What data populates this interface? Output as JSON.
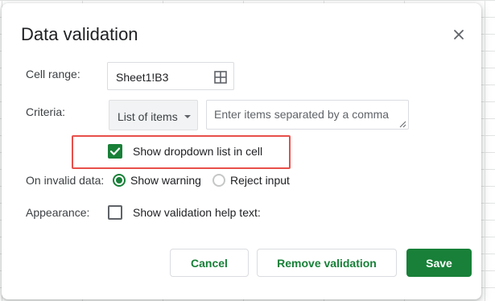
{
  "dialog": {
    "title": "Data validation"
  },
  "cell_range": {
    "label": "Cell range:",
    "value": "Sheet1!B3"
  },
  "criteria": {
    "label": "Criteria:",
    "selected": "List of items",
    "items_placeholder": "Enter items separated by a comma"
  },
  "dropdown_option": {
    "label": "Show dropdown list in cell",
    "checked": true
  },
  "invalid_data": {
    "label": "On invalid data:",
    "options": [
      "Show warning",
      "Reject input"
    ],
    "selected": "Show warning"
  },
  "appearance": {
    "label": "Appearance:",
    "help_text_label": "Show validation help text:",
    "checked": false
  },
  "buttons": {
    "cancel": "Cancel",
    "remove": "Remove validation",
    "save": "Save"
  },
  "colors": {
    "accent": "#188038",
    "highlight": "#e84f4a"
  }
}
